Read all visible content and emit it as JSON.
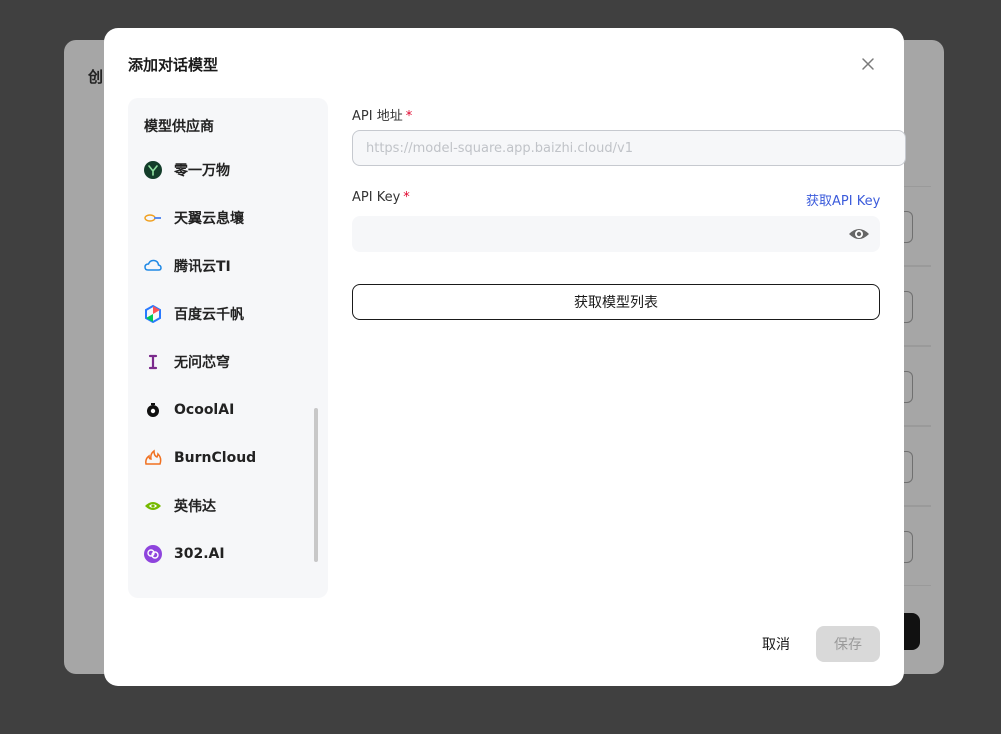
{
  "background": {
    "title": "创",
    "colors": {
      "overlay": "#404040",
      "panel": "#a6a6a6"
    }
  },
  "modal": {
    "title": "添加对话模型",
    "close_icon": "close-icon"
  },
  "sidebar": {
    "heading": "模型供应商",
    "items": [
      {
        "label": "零一万物",
        "icon": "yi-logo-icon"
      },
      {
        "label": "天翼云息壤",
        "icon": "tianyi-logo-icon"
      },
      {
        "label": "腾讯云TI",
        "icon": "tencent-cloud-icon"
      },
      {
        "label": "百度云千帆",
        "icon": "baidu-qianfan-icon"
      },
      {
        "label": "无问芯穹",
        "icon": "infini-logo-icon"
      },
      {
        "label": "OcoolAI",
        "icon": "ocoolai-logo-icon"
      },
      {
        "label": "BurnCloud",
        "icon": "burncloud-flame-icon"
      },
      {
        "label": "英伟达",
        "icon": "nvidia-logo-icon"
      },
      {
        "label": "302.AI",
        "icon": "302ai-logo-icon"
      }
    ]
  },
  "form": {
    "api_url_label": "API 地址",
    "api_url_placeholder": "https://model-square.app.baizhi.cloud/v1",
    "api_key_label": "API Key",
    "required_mark": "*",
    "get_key_link": "获取API Key",
    "fetch_models_label": "获取模型列表"
  },
  "footer": {
    "cancel_label": "取消",
    "save_label": "保存"
  },
  "colors": {
    "link": "#3b5bdb",
    "required": "#e0002a",
    "save_disabled_bg": "#d9d9d9"
  }
}
